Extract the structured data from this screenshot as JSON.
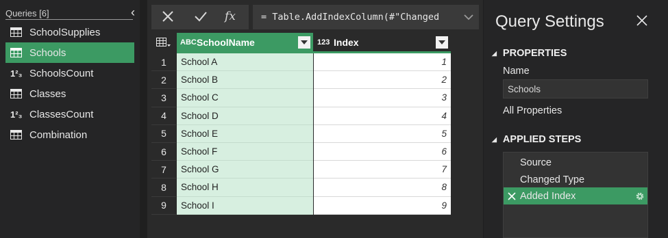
{
  "queries": {
    "header": "Queries [6]",
    "items": [
      {
        "label": "SchoolSupplies",
        "icon": "table-icon",
        "selected": false
      },
      {
        "label": "Schools",
        "icon": "table-icon",
        "selected": true
      },
      {
        "label": "SchoolsCount",
        "icon": "number-type-icon",
        "selected": false
      },
      {
        "label": "Classes",
        "icon": "table-icon",
        "selected": false
      },
      {
        "label": "ClassesCount",
        "icon": "number-type-icon",
        "selected": false
      },
      {
        "label": "Combination",
        "icon": "table-icon",
        "selected": false
      }
    ]
  },
  "formula": {
    "text": "= Table.AddIndexColumn(#\"Changed"
  },
  "grid": {
    "columns": [
      {
        "type": "ABC",
        "label": "SchoolName"
      },
      {
        "type": "123",
        "label": "Index"
      }
    ],
    "rows": [
      {
        "num": "1",
        "name": "School A",
        "index": "1"
      },
      {
        "num": "2",
        "name": "School B",
        "index": "2"
      },
      {
        "num": "3",
        "name": "School C",
        "index": "3"
      },
      {
        "num": "4",
        "name": "School D",
        "index": "4"
      },
      {
        "num": "5",
        "name": "School E",
        "index": "5"
      },
      {
        "num": "6",
        "name": "School F",
        "index": "6"
      },
      {
        "num": "7",
        "name": "School G",
        "index": "7"
      },
      {
        "num": "8",
        "name": "School H",
        "index": "8"
      },
      {
        "num": "9",
        "name": "School I",
        "index": "9"
      }
    ]
  },
  "settings": {
    "title": "Query Settings",
    "properties_title": "PROPERTIES",
    "name_label": "Name",
    "name_value": "Schools",
    "all_properties": "All Properties",
    "steps_title": "APPLIED STEPS",
    "steps": [
      {
        "label": "Source",
        "selected": false
      },
      {
        "label": "Changed Type",
        "selected": false
      },
      {
        "label": "Added Index",
        "selected": true
      }
    ]
  },
  "colors": {
    "accent_green": "#3c9a63",
    "column_highlight": "#d7efe0"
  }
}
